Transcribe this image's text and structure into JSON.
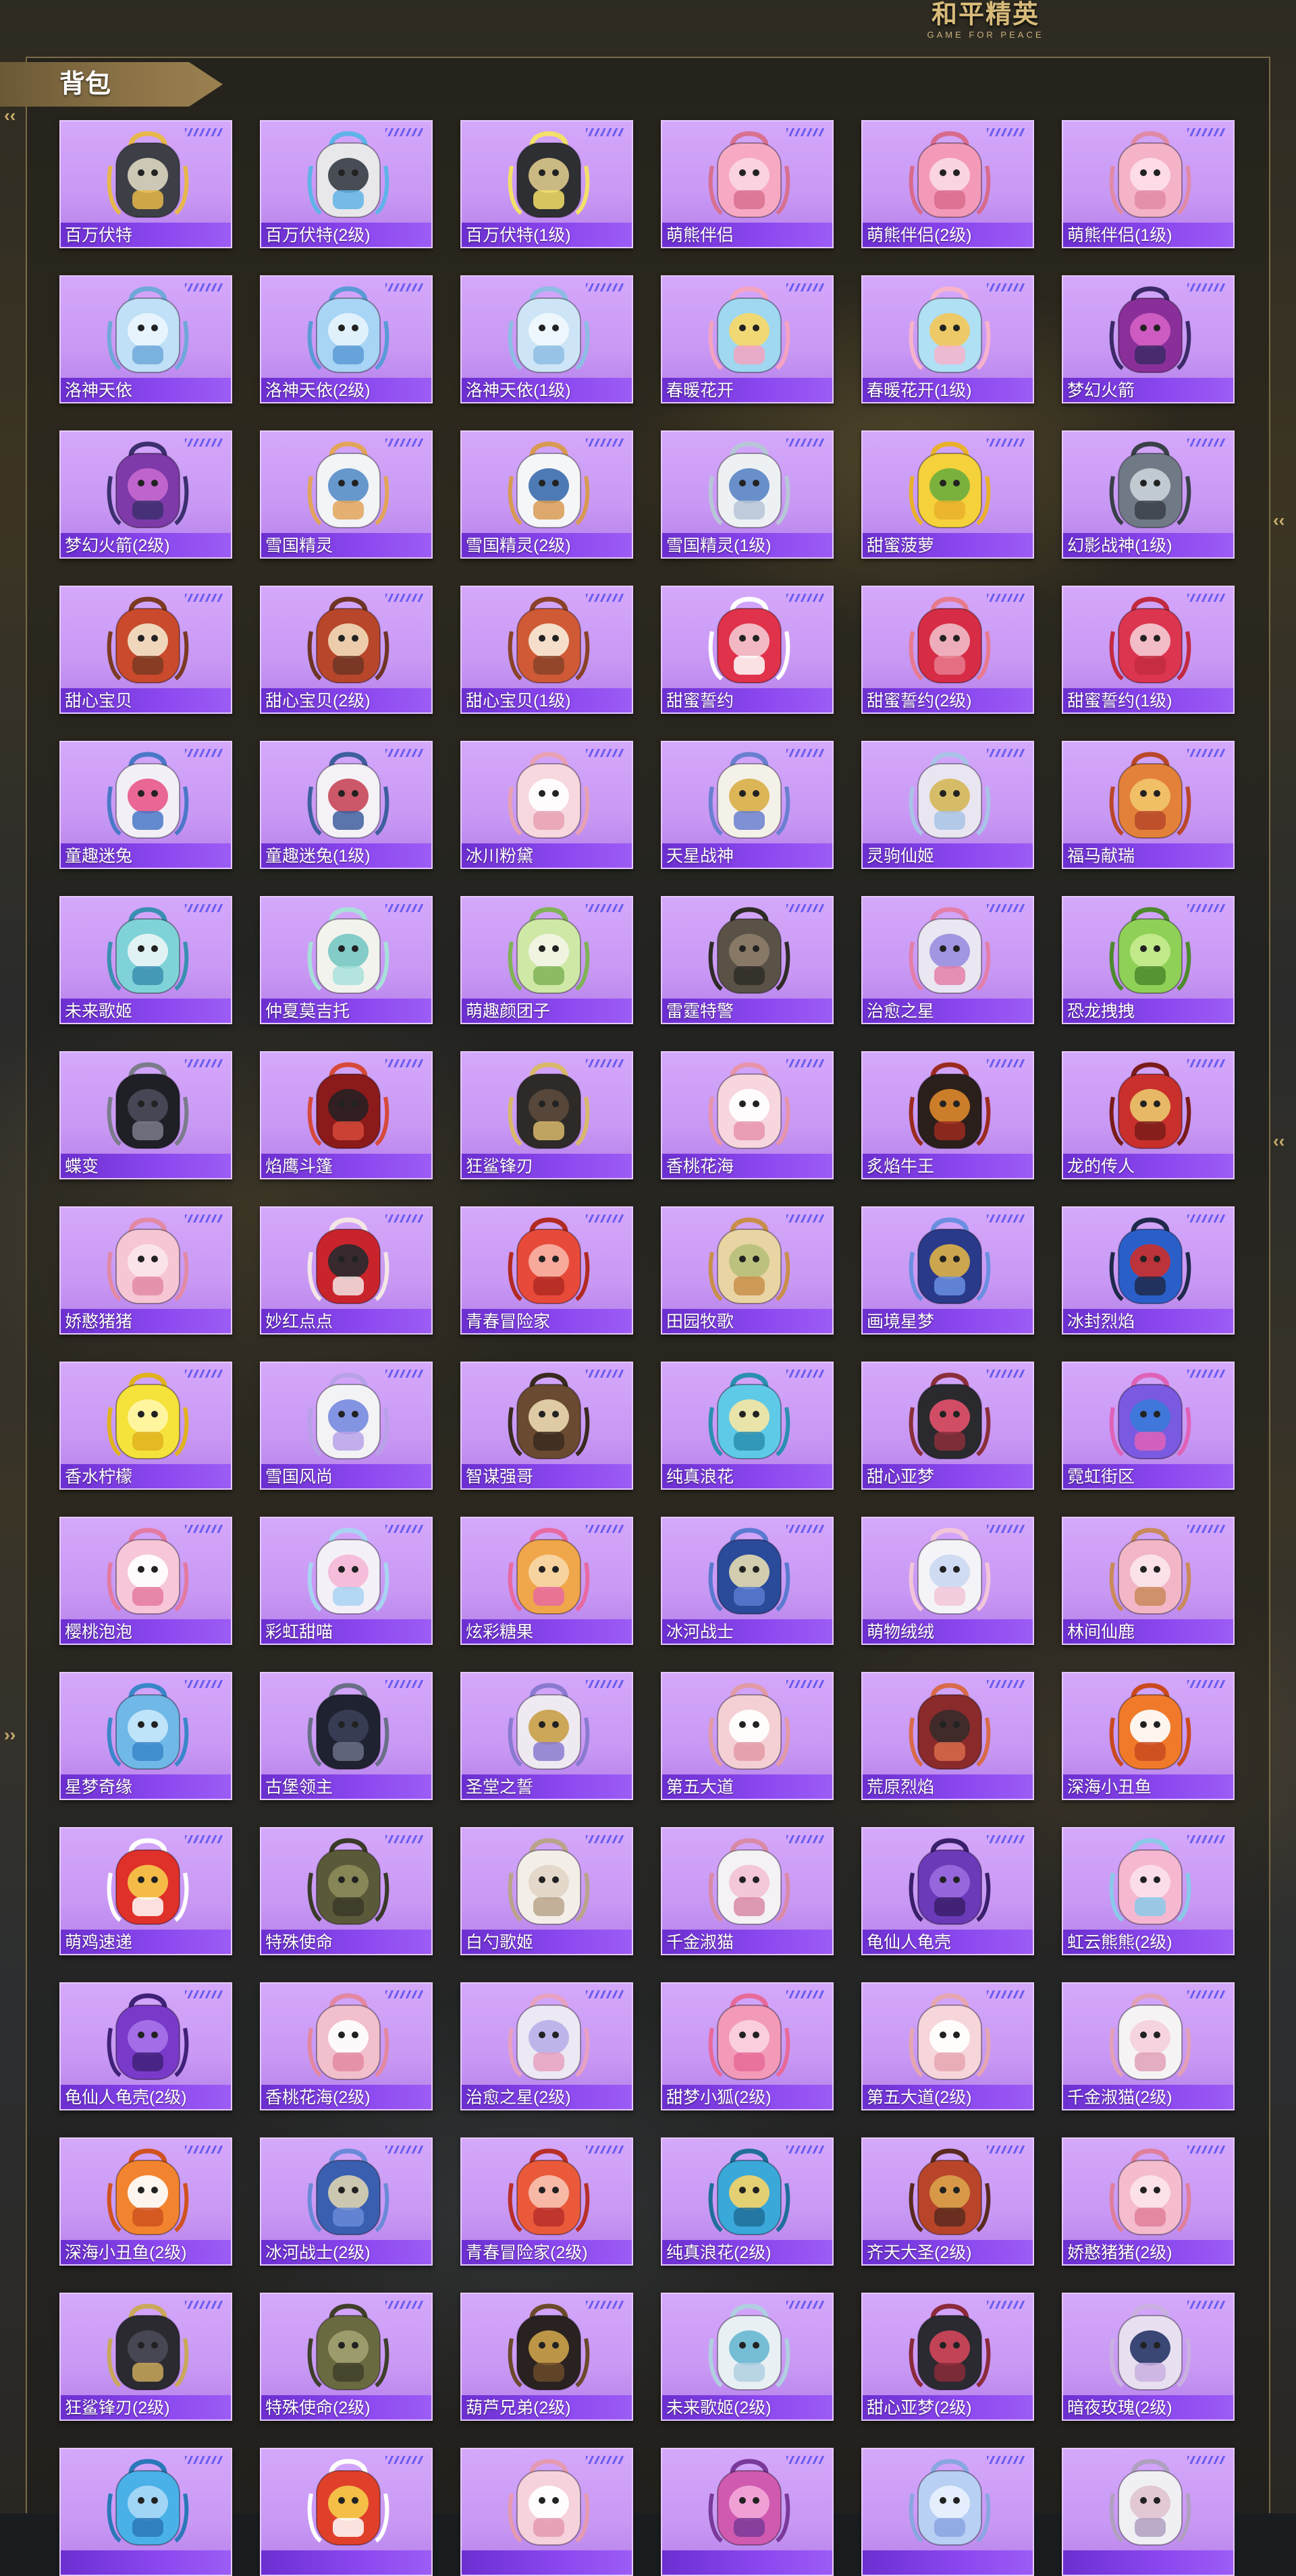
{
  "logo": {
    "title": "和平精英",
    "subtitle": "GAME FOR PEACE"
  },
  "header": {
    "title": "背包"
  },
  "accent_colors": {
    "card_bg": "#c898f4",
    "label_bar": "#7b3be0",
    "header_gold": "#8a7246"
  },
  "items": [
    {
      "name": "百万伏特",
      "colors": [
        "#3d3f46",
        "#d9d4c0",
        "#e6b84a"
      ]
    },
    {
      "name": "百万伏特(2级)",
      "colors": [
        "#e8e8ea",
        "#3a3e48",
        "#5fb3e8"
      ]
    },
    {
      "name": "百万伏特(1级)",
      "colors": [
        "#2e2f33",
        "#d9c68a",
        "#f3e06a"
      ]
    },
    {
      "name": "萌熊伴侣",
      "colors": [
        "#f7a9c4",
        "#fbd6e2",
        "#d8708f"
      ]
    },
    {
      "name": "萌熊伴侣(2级)",
      "colors": [
        "#f39ab8",
        "#fcd9e4",
        "#d86b8c"
      ]
    },
    {
      "name": "萌熊伴侣(1级)",
      "colors": [
        "#f5b3c8",
        "#fde0ea",
        "#e08aa6"
      ]
    },
    {
      "name": "洛神天依",
      "colors": [
        "#bfe0f7",
        "#eaf5fd",
        "#6fa8d9"
      ]
    },
    {
      "name": "洛神天依(2级)",
      "colors": [
        "#a8d4f5",
        "#e6f3fc",
        "#5a9ad6"
      ]
    },
    {
      "name": "洛神天依(1级)",
      "colors": [
        "#cde5f6",
        "#f0f8fd",
        "#8dbde3"
      ]
    },
    {
      "name": "春暖花开",
      "colors": [
        "#9fd8f0",
        "#f6d86a",
        "#f4a3c0"
      ]
    },
    {
      "name": "春暖花开(1级)",
      "colors": [
        "#b0e0f4",
        "#f2c85a",
        "#f7b3cb"
      ]
    },
    {
      "name": "梦幻火箭",
      "colors": [
        "#8a2f9a",
        "#d35fc4",
        "#3b2a66"
      ]
    },
    {
      "name": "梦幻火箭(2级)",
      "colors": [
        "#7e3aa8",
        "#c468cf",
        "#3c2f6e"
      ]
    },
    {
      "name": "雪国精灵",
      "colors": [
        "#f2f4f6",
        "#5b8fc9",
        "#e2a45a"
      ]
    },
    {
      "name": "雪国精灵(2级)",
      "colors": [
        "#f5f6f7",
        "#3e6fae",
        "#d89a52"
      ]
    },
    {
      "name": "雪国精灵(1级)",
      "colors": [
        "#eef1f3",
        "#5c87c7",
        "#b7c6d6"
      ]
    },
    {
      "name": "甜蜜菠萝",
      "colors": [
        "#f5d13b",
        "#6fae3e",
        "#e9b02c"
      ]
    },
    {
      "name": "幻影战神(1级)",
      "colors": [
        "#6f7a86",
        "#c9d0d8",
        "#3a4048"
      ]
    },
    {
      "name": "甜心宝贝",
      "colors": [
        "#c94a2c",
        "#f3e2c8",
        "#7b3a22"
      ]
    },
    {
      "name": "甜心宝贝(2级)",
      "colors": [
        "#b8462b",
        "#f1d8b6",
        "#6e3524"
      ]
    },
    {
      "name": "甜心宝贝(1级)",
      "colors": [
        "#d05a36",
        "#f7ead8",
        "#8a4328"
      ]
    },
    {
      "name": "甜蜜誓约",
      "colors": [
        "#e0324a",
        "#f3c4cf",
        "#ffffff"
      ]
    },
    {
      "name": "甜蜜誓约(2级)",
      "colors": [
        "#d72c45",
        "#f0b8c4",
        "#e87a8e"
      ]
    },
    {
      "name": "甜蜜誓约(1级)",
      "colors": [
        "#dc3550",
        "#f4c9d2",
        "#c22a40"
      ]
    },
    {
      "name": "童趣迷兔",
      "colors": [
        "#f2f0f6",
        "#e85a8c",
        "#4a78c7"
      ]
    },
    {
      "name": "童趣迷兔(1级)",
      "colors": [
        "#f4f2f7",
        "#c84a5c",
        "#3e5f9e"
      ]
    },
    {
      "name": "冰川粉黛",
      "colors": [
        "#f7d8df",
        "#ffffff",
        "#e7a1b3"
      ]
    },
    {
      "name": "天星战神",
      "colors": [
        "#f4f1e8",
        "#d9b04a",
        "#6a7fd0"
      ]
    },
    {
      "name": "灵驹仙姬",
      "colors": [
        "#e9e6f2",
        "#d4b85a",
        "#a9c3e6"
      ]
    },
    {
      "name": "福马献瑞",
      "colors": [
        "#e3813a",
        "#f2c46a",
        "#b9482a"
      ]
    },
    {
      "name": "未来歌姬",
      "colors": [
        "#7fd3d8",
        "#e9f4f6",
        "#3a8fb0"
      ]
    },
    {
      "name": "仲夏莫吉托",
      "colors": [
        "#f3f3ee",
        "#79c9c4",
        "#a7e0d9"
      ]
    },
    {
      "name": "萌趣颜团子",
      "colors": [
        "#cfe8a6",
        "#f4f4e6",
        "#7fb356"
      ]
    },
    {
      "name": "雷霆特警",
      "colors": [
        "#5a5247",
        "#8b7d69",
        "#2f2b27"
      ]
    },
    {
      "name": "治愈之星",
      "colors": [
        "#eae7f2",
        "#9a8fe0",
        "#e37fa8"
      ]
    },
    {
      "name": "恐龙拽拽",
      "colors": [
        "#8fd057",
        "#c7ec8f",
        "#4c8a2c"
      ]
    },
    {
      "name": "蝶变",
      "colors": [
        "#1f1f26",
        "#4a4a58",
        "#7b7b8c"
      ]
    },
    {
      "name": "焰鹰斗篷",
      "colors": [
        "#8c1a1a",
        "#2a1f22",
        "#d64a3a"
      ]
    },
    {
      "name": "狂鲨锋刃",
      "colors": [
        "#2d2a28",
        "#5a4a3c",
        "#d9b86a"
      ]
    },
    {
      "name": "香桃花海",
      "colors": [
        "#f7d6de",
        "#ffffff",
        "#e794ab"
      ]
    },
    {
      "name": "炙焰牛王",
      "colors": [
        "#2b1f1c",
        "#d9862a",
        "#9a2b1f"
      ]
    },
    {
      "name": "龙的传人",
      "colors": [
        "#c9302c",
        "#e9c46a",
        "#7a1c1a"
      ]
    },
    {
      "name": "娇憨猪猪",
      "colors": [
        "#f6c6d4",
        "#fbe5ec",
        "#e28aa5"
      ]
    },
    {
      "name": "妙红点点",
      "colors": [
        "#c9242c",
        "#2a2a2e",
        "#f4e6e6"
      ]
    },
    {
      "name": "青春冒险家",
      "colors": [
        "#e84a3a",
        "#f7b1a4",
        "#b22a22"
      ]
    },
    {
      "name": "田园牧歌",
      "colors": [
        "#e9d5a4",
        "#b7c07a",
        "#c98f4a"
      ]
    },
    {
      "name": "画境星梦",
      "colors": [
        "#2a3a8a",
        "#d9b04a",
        "#6a8fe0"
      ]
    },
    {
      "name": "冰封烈焰",
      "colors": [
        "#2a5fc9",
        "#c93030",
        "#1f2a4a"
      ]
    },
    {
      "name": "香水柠檬",
      "colors": [
        "#f5e23a",
        "#fff6a8",
        "#e0b21f"
      ]
    },
    {
      "name": "雪国风尚",
      "colors": [
        "#f3f3f6",
        "#7a8ce0",
        "#b9a1e8"
      ]
    },
    {
      "name": "智谋强哥",
      "colors": [
        "#6a4a30",
        "#e8d5b0",
        "#3a2a1f"
      ]
    },
    {
      "name": "纯真浪花",
      "colors": [
        "#5fc9e8",
        "#f4e6a4",
        "#2a8fb0"
      ]
    },
    {
      "name": "甜心亚梦",
      "colors": [
        "#2a2a2e",
        "#e0506a",
        "#8a2f3a"
      ]
    },
    {
      "name": "霓虹街区",
      "colors": [
        "#7a5ae0",
        "#3a7ad9",
        "#e062b8"
      ]
    },
    {
      "name": "樱桃泡泡",
      "colors": [
        "#f7c6d8",
        "#ffffff",
        "#e47aa0"
      ]
    },
    {
      "name": "彩虹甜喵",
      "colors": [
        "#f4f0f8",
        "#f4b8d6",
        "#a8d4f2"
      ]
    },
    {
      "name": "炫彩糖果",
      "colors": [
        "#f0a64a",
        "#f7d7a6",
        "#e86aa0"
      ]
    },
    {
      "name": "冰河战士",
      "colors": [
        "#2a4a9a",
        "#e0d8b0",
        "#5a7ad0"
      ]
    },
    {
      "name": "萌物绒绒",
      "colors": [
        "#f4f4f8",
        "#cbd8f2",
        "#f2c6d8"
      ]
    },
    {
      "name": "林间仙鹿",
      "colors": [
        "#f2b6c6",
        "#fbe6ea",
        "#c98a5a"
      ]
    },
    {
      "name": "星梦奇缘",
      "colors": [
        "#6fb8e8",
        "#c6e6f8",
        "#3a86c9"
      ]
    },
    {
      "name": "古堡领主",
      "colors": [
        "#1f2230",
        "#3a3f58",
        "#6a6f88"
      ]
    },
    {
      "name": "圣堂之誓",
      "colors": [
        "#efeaf2",
        "#c9a14a",
        "#8a7ad0"
      ]
    },
    {
      "name": "第五大道",
      "colors": [
        "#f4d0d4",
        "#ffffff",
        "#e29aa6"
      ]
    },
    {
      "name": "荒原烈焰",
      "colors": [
        "#8a2a2a",
        "#3a2a2a",
        "#d96a4a"
      ]
    },
    {
      "name": "深海小丑鱼",
      "colors": [
        "#f07a2a",
        "#ffffff",
        "#c94a1f"
      ]
    },
    {
      "name": "萌鸡速递",
      "colors": [
        "#e0302a",
        "#f5c94a",
        "#ffffff"
      ]
    },
    {
      "name": "特殊使命",
      "colors": [
        "#5a5a3a",
        "#8a8a5a",
        "#3a3a28"
      ]
    },
    {
      "name": "白勺歌姬",
      "colors": [
        "#f3efe8",
        "#e2d6c6",
        "#b9a48a"
      ]
    },
    {
      "name": "千金淑猫",
      "colors": [
        "#f4f2f4",
        "#f2c2d6",
        "#d98aa6"
      ]
    },
    {
      "name": "龟仙人龟壳",
      "colors": [
        "#6a3ab8",
        "#9a6ae0",
        "#3a1f6a"
      ]
    },
    {
      "name": "虹云熊熊(2级)",
      "colors": [
        "#f6b8d0",
        "#fbe0ea",
        "#8ac9e8"
      ]
    },
    {
      "name": "龟仙人龟壳(2级)",
      "colors": [
        "#7a3ac9",
        "#a672ea",
        "#3f2278"
      ]
    },
    {
      "name": "香桃花海(2级)",
      "colors": [
        "#f2bfcc",
        "#ffffff",
        "#e388a0"
      ]
    },
    {
      "name": "治愈之星(2级)",
      "colors": [
        "#ece8f4",
        "#b9b0e8",
        "#e7a1c0"
      ]
    },
    {
      "name": "甜梦小狐(2级)",
      "colors": [
        "#f29ab8",
        "#fbd2e0",
        "#e86a98"
      ]
    },
    {
      "name": "第五大道(2级)",
      "colors": [
        "#f6d6da",
        "#ffffff",
        "#e6a6b0"
      ]
    },
    {
      "name": "千金淑猫(2级)",
      "colors": [
        "#f6f3f4",
        "#f4d0dc",
        "#e2a0b8"
      ]
    },
    {
      "name": "深海小丑鱼(2级)",
      "colors": [
        "#f2842f",
        "#ffffff",
        "#d0521f"
      ]
    },
    {
      "name": "冰河战士(2级)",
      "colors": [
        "#3a5fb0",
        "#d8d0b0",
        "#6a8ad8"
      ]
    },
    {
      "name": "青春冒险家(2级)",
      "colors": [
        "#ea5a3a",
        "#f8c0b0",
        "#b8302a"
      ]
    },
    {
      "name": "纯真浪花(2级)",
      "colors": [
        "#3aa8d8",
        "#f2d46a",
        "#1f6f9a"
      ]
    },
    {
      "name": "齐天大圣(2级)",
      "colors": [
        "#b8452a",
        "#d9a14a",
        "#5a2a1f"
      ]
    },
    {
      "name": "娇憨猪猪(2级)",
      "colors": [
        "#f4bccc",
        "#fce4ea",
        "#e07f9a"
      ]
    },
    {
      "name": "狂鲨锋刃(2级)",
      "colors": [
        "#2a2a30",
        "#4a4a58",
        "#c9a85a"
      ]
    },
    {
      "name": "特殊使命(2级)",
      "colors": [
        "#6a6a40",
        "#a0a070",
        "#3f3f2a"
      ]
    },
    {
      "name": "葫芦兄弟(2级)",
      "colors": [
        "#2a2220",
        "#c9a04a",
        "#6a4a2a"
      ]
    },
    {
      "name": "未来歌姬(2级)",
      "colors": [
        "#e8f0f4",
        "#6ab8d0",
        "#b0cfe0"
      ]
    },
    {
      "name": "甜心亚梦(2级)",
      "colors": [
        "#2a2a30",
        "#d0455a",
        "#8a2a3a"
      ]
    },
    {
      "name": "暗夜玫瑰(2级)",
      "colors": [
        "#e8e0f0",
        "#2a3a6a",
        "#c9b0e0"
      ]
    },
    {
      "name": "",
      "colors": [
        "#4ab0e8",
        "#a8d8f6",
        "#2a78b8"
      ]
    },
    {
      "name": "",
      "colors": [
        "#e0402a",
        "#f5c94a",
        "#ffffff"
      ]
    },
    {
      "name": "",
      "colors": [
        "#f6d2dc",
        "#ffffff",
        "#e49ab0"
      ]
    },
    {
      "name": "",
      "colors": [
        "#d05ab0",
        "#f2a6d8",
        "#7a3a9a"
      ]
    },
    {
      "name": "",
      "colors": [
        "#b8d0f4",
        "#e8f0fc",
        "#8aa6e0"
      ]
    },
    {
      "name": "",
      "colors": [
        "#f0f0f4",
        "#e0c4d0",
        "#b0a0c0"
      ]
    }
  ]
}
